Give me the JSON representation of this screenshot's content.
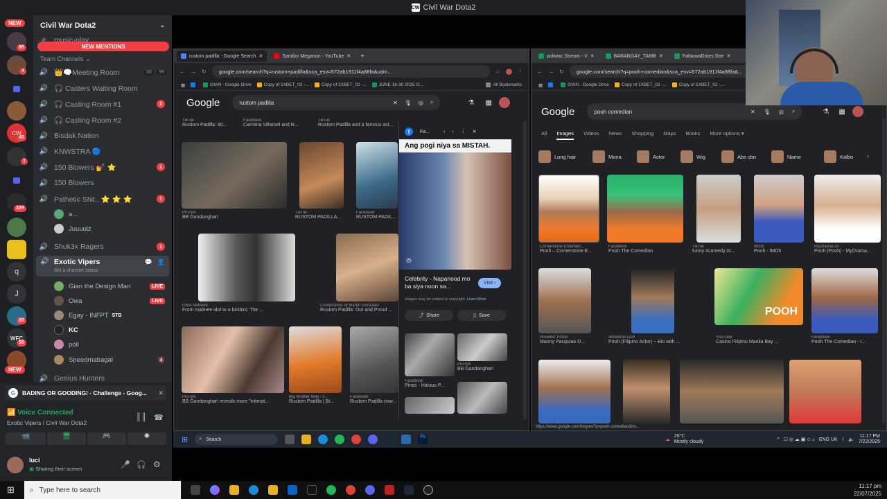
{
  "window": {
    "title": "Civil War Dota2"
  },
  "guildbar": {
    "new_top": "NEW",
    "new_bottom": "NEW",
    "badges": [
      "88",
      "4",
      "45",
      "1",
      "329",
      "20",
      "58"
    ],
    "letters": [
      "q",
      "J",
      "WFC"
    ]
  },
  "server": {
    "name": "Civil War Dota2",
    "partial_channel": "music-play",
    "partial_count": "16",
    "new_mentions": "NEW MENTIONS",
    "category": "Team Channels",
    "channels": [
      {
        "label": "👑🗨️Meeting Room",
        "meta": "00",
        "meta2": "99"
      },
      {
        "label": "🎧 Casters Waiting Room"
      },
      {
        "label": "🎧 Casting Room #1",
        "count": "2"
      },
      {
        "label": "🎧 Casting Room #2"
      },
      {
        "label": "Bisdak Nation"
      },
      {
        "label": "KNWSTRA 🔵"
      },
      {
        "label": "150 Blowers 💅 ⭐",
        "count": "1"
      },
      {
        "label": "150 Blowers"
      },
      {
        "label": "Pathetic Shit.. ⭐ ⭐ ⭐",
        "count": "1"
      }
    ],
    "pathetic_users": [
      "a...",
      "Juuuulz"
    ],
    "shuk_channel": "Shuk3x Ragers",
    "shuk_count": "1",
    "exotic": {
      "label": "Exotic Vipers",
      "status": "Set a channel status"
    },
    "exotic_users": [
      {
        "name": "Gian the Design Man",
        "live": "LIVE"
      },
      {
        "name": "Owa",
        "live": "LIVE"
      },
      {
        "name": "Egay - INFPT",
        "tag": "STB"
      },
      {
        "name": "KC"
      },
      {
        "name": "poli"
      },
      {
        "name": "Speedmabagal"
      }
    ],
    "next_channel": "Genius Hunters"
  },
  "voice": {
    "notification": "BADING OR GOODING! - Challenge - Goog...",
    "connected": "Voice Connected",
    "location": "Exotic Vipers / Civil War Dota2",
    "user_name": "luci",
    "user_status": "Sharing their screen"
  },
  "browser_left": {
    "tabs": [
      "rustom padilla - Google Search",
      "Saridon Meganon - YouTube"
    ],
    "url": "google.com/search?q=rustom+padilla&sca_esv=572ab1811f4a88fa&udm...",
    "bookmarks": [
      "GIAN - Google Drive",
      "Copy of 1XBET_02 -...",
      "Copy of 1XBET_02 -...",
      "JUNE 16-30 2025 O...",
      "All Bookmarks"
    ],
    "search": "rustom padilla",
    "logo": "Google",
    "top_captions": [
      {
        "src": "TikTok",
        "text": "Rustom Padilla: 90..."
      },
      {
        "src": "Facebook",
        "text": "Carmina Villaroel and R..."
      },
      {
        "src": "TikTok",
        "text": "Rustom Padilla and a famous act..."
      }
    ],
    "row1_captions": [
      {
        "src": "PEP.ph",
        "text": "BB Gandanghari"
      },
      {
        "src": "TikTok",
        "text": "RUSTOM PADILLA..."
      },
      {
        "src": "Facebook",
        "text": "RUSTOM PADIL..."
      }
    ],
    "row2_captions": [
      {
        "src": "GMA Network",
        "text": "From matinee idol to a binibini: The ..."
      },
      {
        "src": "Confessions of Martin Gonzales",
        "text": "Rustom Padilla: Out and Proud ..."
      }
    ],
    "row3_captions": [
      {
        "src": "PEP.ph",
        "text": "BB Gandanghari reveals more \"intimat..."
      },
      {
        "src": "Big Brother Wiki - F...",
        "text": "Rustom Padilla | Bi..."
      },
      {
        "src": "Facebook",
        "text": "Rustom Padilla now..."
      }
    ],
    "preview": {
      "source": "Fa...",
      "title": "Ang pogi niya sa MISTAH.",
      "caption": "Celebrity - Napanood mo ba siya noon sa...",
      "visit": "Visit",
      "copyright": "Images may be subject to copyright.",
      "learn_more": "Learn More",
      "share": "Share",
      "save": "Save",
      "related": [
        {
          "src": "PEP.ph",
          "text": "BB Gandanghari"
        },
        {
          "src": "Facebook",
          "text": "Pinas - Haluuu P..."
        }
      ]
    },
    "taskbar": {
      "search": "Search",
      "weather": "26°C",
      "weather_desc": "Mostly cloudy",
      "lang": "ENG UK",
      "time": "11:17 PM",
      "date": "7/22/2025"
    }
  },
  "browser_right": {
    "tabs": [
      "poliwac Stream - V",
      "BARANGAY_TAMB",
      "FafaowaDotes Stre"
    ],
    "url": "google.com/search?q=pooh+comedian&sca_esv=572ab1811f4a88fa&...",
    "bookmarks": [
      "GIAN - Google Drive",
      "Copy of 1XBET_02 -...",
      "Copy of 1XBET_02 -..."
    ],
    "search": "pooh comedian",
    "logo": "Google",
    "nav_tabs": [
      "All",
      "Images",
      "Videos",
      "News",
      "Shopping",
      "Maps",
      "Books",
      "More options"
    ],
    "chips": [
      "Long hair",
      "Mona",
      "Actor",
      "Wig",
      "Abs cbn",
      "Name",
      "Kalbo"
    ],
    "row1": [
      {
        "src": "Cornerstone Entertain...",
        "text": "Pooh – Cornerstone E..."
      },
      {
        "src": "Facebook",
        "text": "Pooh The Comedian"
      },
      {
        "src": "TikTok",
        "text": "funny #comedy #c..."
      },
      {
        "src": "IMDb",
        "text": "Pooh - IMDb"
      },
      {
        "src": "MyDramaList",
        "text": "Pooh (Pooh) - MyDrama..."
      }
    ],
    "row2": [
      {
        "src": "Showbiz Portal",
        "text": "Manny Pacquiao D..."
      },
      {
        "src": "Alchetron.com",
        "text": "Pooh (Filipino Actor) ~ Bio with ..."
      },
      {
        "src": "YouTube",
        "text": "Casino Filipino Manila Bay ..."
      },
      {
        "src": "Facebook",
        "text": "Pooh The Comedian - I..."
      }
    ],
    "banner_text": "POOH",
    "status_url": "https://www.google.com/imgres?q=pooh comedian&im..."
  },
  "taskbar": {
    "search_placeholder": "Type here to search",
    "time": "11:17 pm",
    "date": "22/07/2025"
  }
}
